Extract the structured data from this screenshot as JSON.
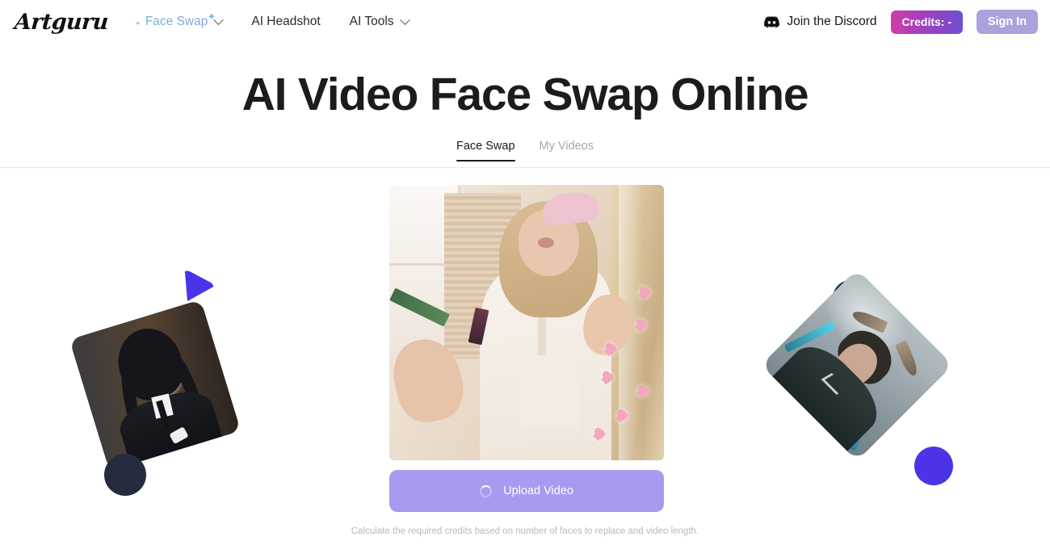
{
  "header": {
    "logo": "Artguru",
    "nav": [
      {
        "label": "Face Swap",
        "has_chevron": true,
        "gradient": true,
        "sparkle_left_icon": "sparkle-icon",
        "sparkle_right_icon": "sparkle-icon"
      },
      {
        "label": "AI Headshot",
        "has_chevron": false,
        "gradient": false
      },
      {
        "label": "AI Tools",
        "has_chevron": true,
        "gradient": false
      }
    ],
    "discord": {
      "label": "Join the Discord",
      "icon": "discord-icon"
    },
    "credits_button": {
      "label": "Credits: -",
      "gradient_from": "#cf3fa7",
      "gradient_to": "#6e4fd0"
    },
    "signin_button": {
      "label": "Sign In",
      "color": "#a9a2dd"
    }
  },
  "main": {
    "title": "AI Video Face Swap Online",
    "tabs": [
      {
        "label": "Face Swap",
        "active": true
      },
      {
        "label": "My Videos",
        "active": false
      }
    ],
    "upload_button": {
      "label": "Upload Video",
      "icon": "loading-spinner-icon",
      "color": "#a89af0"
    },
    "note": "Calculate the required credits based on number of faces to replace and video length."
  },
  "decorations": {
    "left_card": {
      "alt": "wednesday-addams-photo",
      "rotation_deg": -17
    },
    "left_triangle": {
      "icon": "play-triangle-icon",
      "color": "#4b34e8"
    },
    "left_circle": {
      "color": "#252c3e"
    },
    "right_card": {
      "alt": "loki-photo",
      "rotation_deg": 45
    },
    "right_circle_navy": {
      "color": "#242b44"
    },
    "right_circle_blue": {
      "color": "#4b34e8"
    },
    "center_video": {
      "alt": "woman-applying-makeup-video-preview"
    }
  }
}
